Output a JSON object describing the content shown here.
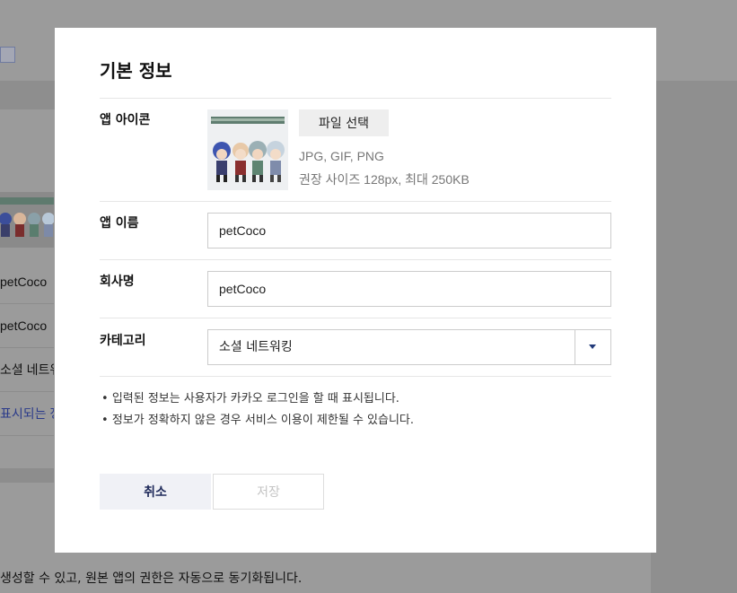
{
  "background": {
    "rows": [
      "petCoco",
      "petCoco",
      "소셜 네트워"
    ],
    "link_text": "표시되는 정보",
    "footer_text": "생성할 수 있고, 원본 앱의 권한은 자동으로 동기화됩니다."
  },
  "modal": {
    "title": "기본 정보",
    "app_icon": {
      "label": "앱 아이콘",
      "file_button": "파일 선택",
      "formats": "JPG, GIF, PNG",
      "size_hint": "권장 사이즈 128px, 최대 250KB"
    },
    "app_name": {
      "label": "앱 이름",
      "value": "petCoco"
    },
    "company": {
      "label": "회사명",
      "value": "petCoco"
    },
    "category": {
      "label": "카테고리",
      "selected": "소셜 네트워킹"
    },
    "notes": [
      "입력된 정보는 사용자가 카카오 로그인을 할 때 표시됩니다.",
      "정보가 정확하지 않은 경우 서비스 이용이 제한될 수 있습니다."
    ],
    "buttons": {
      "cancel": "취소",
      "save": "저장"
    }
  },
  "colors": {
    "overlay": "#9b9b9b",
    "accent": "#1f2a5a",
    "disabled_text": "#c4c4c4"
  }
}
